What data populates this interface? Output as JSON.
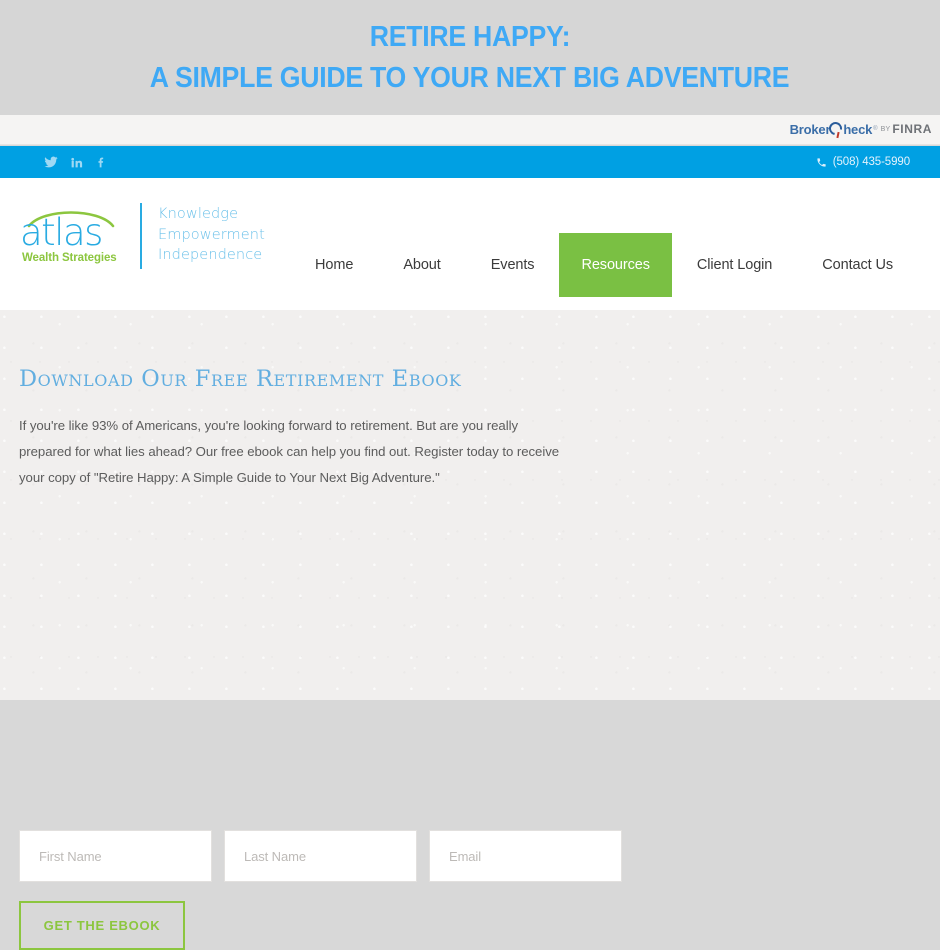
{
  "banner": {
    "line1": "RETIRE HAPPY:",
    "line2": "A SIMPLE GUIDE TO YOUR NEXT BIG ADVENTURE",
    "text_color": "#3fa9f5",
    "background_color": "#d6d6d6"
  },
  "brokercheck": {
    "broker_text": "Broker",
    "check_text": "heck",
    "tm": "®",
    "by_text": "BY",
    "finra_text": "FINRA",
    "brand_color": "#3b6ea8"
  },
  "topbar": {
    "background_color": "#00a0e3",
    "socials": [
      {
        "name": "twitter-icon",
        "label": "Twitter"
      },
      {
        "name": "linkedin-icon",
        "label": "LinkedIn"
      },
      {
        "name": "facebook-icon",
        "label": "Facebook"
      }
    ],
    "phone_icon": "phone-icon",
    "phone": "(508) 435-5990"
  },
  "header": {
    "logo": {
      "wordmark": "atlas",
      "subtitle": "Wealth Strategies",
      "wordmark_color": "#29abe2",
      "subtitle_color": "#8cc63f",
      "tagline": [
        "Knowledge",
        "Empowerment",
        "Independence"
      ]
    },
    "nav": [
      {
        "label": "Home",
        "active": false
      },
      {
        "label": "About",
        "active": false
      },
      {
        "label": "Events",
        "active": false
      },
      {
        "label": "Resources",
        "active": true
      },
      {
        "label": "Client Login",
        "active": false
      },
      {
        "label": "Contact Us",
        "active": false
      }
    ],
    "active_nav_color": "#7ac043"
  },
  "main": {
    "headline": "Download Our Free Retirement Ebook",
    "headline_color": "#62aee0",
    "paragraph_lines": [
      "If you're like 93% of Americans, you're looking forward to retirement. But are you really",
      "prepared for what lies ahead? Our free ebook can help you find out. Register today to receive",
      "your copy of \"Retire Happy: A Simple Guide to Your Next Big Adventure.\""
    ],
    "form": {
      "fields": [
        {
          "name": "first-name-input",
          "placeholder": "First Name",
          "value": ""
        },
        {
          "name": "last-name-input",
          "placeholder": "Last Name",
          "value": ""
        },
        {
          "name": "email-input",
          "placeholder": "Email",
          "value": ""
        }
      ],
      "submit_label": "GET THE EBOOK",
      "submit_color": "#8cc63f"
    }
  }
}
